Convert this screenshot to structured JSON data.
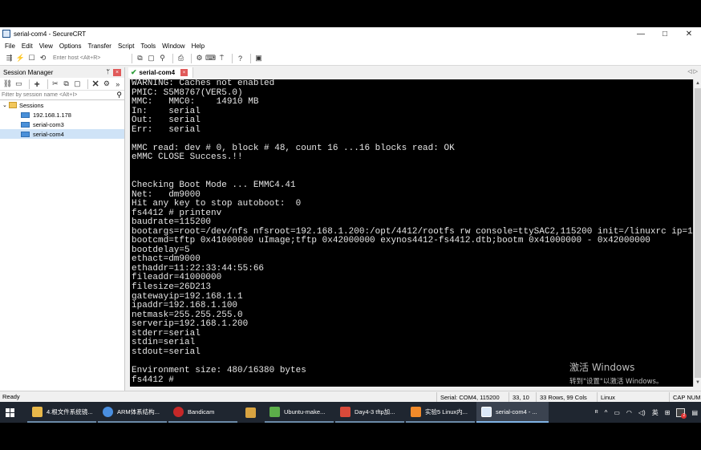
{
  "window": {
    "title": "serial-com4 - SecureCRT",
    "controls": {
      "minimize": "—",
      "maximize": "□",
      "close": "✕"
    }
  },
  "menu": [
    "File",
    "Edit",
    "View",
    "Options",
    "Transfer",
    "Script",
    "Tools",
    "Window",
    "Help"
  ],
  "toolbar": {
    "host_placeholder": "Enter host <Alt+R>"
  },
  "session_manager": {
    "title": "Session Manager",
    "pin": "ᛘ",
    "close": "×",
    "filter_placeholder": "Filter by session name <Alt+I>",
    "root": "Sessions",
    "items": [
      {
        "label": "192.168.1.178",
        "selected": false
      },
      {
        "label": "serial-com3",
        "selected": false
      },
      {
        "label": "serial-com4",
        "selected": true
      }
    ]
  },
  "tabs": {
    "active_label": "serial-com4",
    "close": "×",
    "nav": "◁ ▷"
  },
  "terminal": {
    "lines": [
      "WARNING: Caches not enabled",
      "PMIC: S5M8767(VER5.0)",
      "MMC:   MMC0:    14910 MB",
      "In:    serial",
      "Out:   serial",
      "Err:   serial",
      "",
      "MMC read: dev # 0, block # 48, count 16 ...16 blocks read: OK",
      "eMMC CLOSE Success.!!",
      "",
      "",
      "Checking Boot Mode ... EMMC4.41",
      "Net:   dm9000",
      "Hit any key to stop autoboot:  0",
      "fs4412 # printenv",
      "baudrate=115200",
      "bootargs=root=/dev/nfs nfsroot=192.168.1.200:/opt/4412/rootfs rw console=ttySAC2,115200 init=/linuxrc ip=192.168.1.100",
      "bootcmd=tftp 0x41000000 uImage;tftp 0x42000000 exynos4412-fs4412.dtb;bootm 0x41000000 - 0x42000000",
      "bootdelay=5",
      "ethact=dm9000",
      "ethaddr=11:22:33:44:55:66",
      "fileaddr=41000000",
      "filesize=26D213",
      "gatewayip=192.168.1.1",
      "ipaddr=192.168.1.100",
      "netmask=255.255.255.0",
      "serverip=192.168.1.200",
      "stderr=serial",
      "stdin=serial",
      "stdout=serial",
      "",
      "Environment size: 480/16380 bytes",
      "fs4412 # "
    ]
  },
  "watermark": {
    "line1": "激活 Windows",
    "line2": "转到\"设置\"以激活 Windows。"
  },
  "status": {
    "ready": "Ready",
    "serial": "Serial: COM4, 115200",
    "cursor": "33, 10",
    "size": "33 Rows, 99 Cols",
    "os": "Linux",
    "caps": "CAP NUM"
  },
  "taskbar": {
    "tasks": [
      {
        "label": "4.根文件系统镜...",
        "color": "#e8b84a"
      },
      {
        "label": "ARM体系结构...",
        "color": "#4a8fe0"
      },
      {
        "label": "Bandicam",
        "color": "#c62828"
      },
      {
        "label": "",
        "color": "#d9a441"
      },
      {
        "label": "Ubuntu-make...",
        "color": "#5cae4a"
      },
      {
        "label": "Day4-3 tftp加...",
        "color": "#d84a3a"
      },
      {
        "label": "实验5 Linux内...",
        "color": "#f08a2a"
      },
      {
        "label": "serial-com4 - ...",
        "color": "#dbe8f8"
      }
    ],
    "tray": {
      "person": "ᴿ",
      "chevron": "^",
      "ime": "英",
      "grid": "⊞",
      "badge": "2"
    }
  },
  "colors": {
    "terminal_bg": "#000000",
    "terminal_fg": "#e6e6e6",
    "taskbar_bg": "#1f2630",
    "selection": "#cfe3f7",
    "tab_check": "#2e9e3a"
  }
}
